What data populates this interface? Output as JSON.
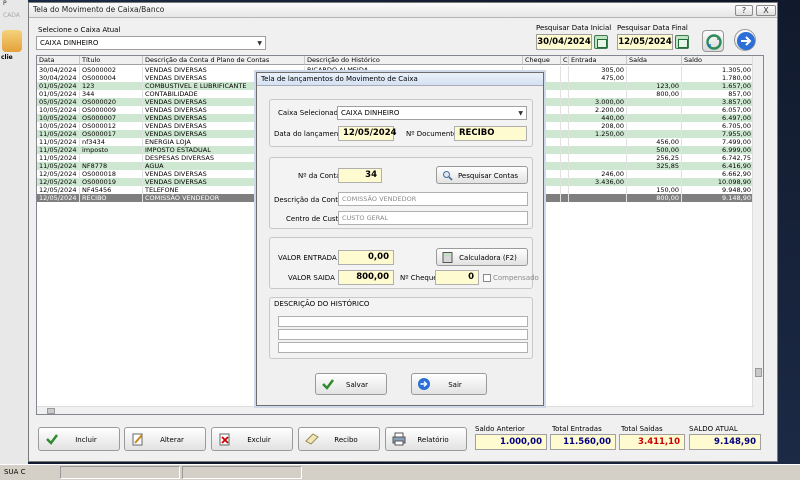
{
  "desktop": {
    "app_label": "P",
    "cad_label": "CADA",
    "user_label": "clie"
  },
  "status_bar": {
    "text": "SUA C"
  },
  "window": {
    "title": "Tela do Movimento de Caixa/Banco",
    "help_label": "?",
    "close_label": "X"
  },
  "filters": {
    "caixa_label": "Selecione o Caixa Atual",
    "caixa_value": "CAIXA DINHEIRO",
    "data_inicial_label": "Pesquisar Data Inicial",
    "data_inicial_value": "30/04/2024",
    "data_final_label": "Pesquisar Data Final",
    "data_final_value": "12/05/2024"
  },
  "grid": {
    "columns": [
      "Data",
      "Título",
      "Descrição da Conta d Plano de Contas",
      "Descrição do Histórico",
      "Cheque",
      "C",
      "Entrada",
      "Saída",
      "Saldo"
    ],
    "rows": [
      {
        "data": "30/04/2024",
        "titulo": "OS000002",
        "conta": "VENDAS DIVERSAS",
        "historico": "RICARDO ALMEIDA",
        "cheque": "",
        "c": "",
        "entrada": "305,00",
        "saida": "",
        "saldo": "1.305,00",
        "color": "white"
      },
      {
        "data": "30/04/2024",
        "titulo": "OS000004",
        "conta": "VENDAS DIVERSAS",
        "historico": "",
        "cheque": "",
        "c": "",
        "entrada": "475,00",
        "saida": "",
        "saldo": "1.780,00",
        "color": "white"
      },
      {
        "data": "01/05/2024",
        "titulo": "123",
        "conta": "COMBUSTIVEL E LUBRIFICANTE",
        "historico": "",
        "cheque": "",
        "c": "",
        "entrada": "",
        "saida": "123,00",
        "saldo": "1.657,00",
        "color": "green"
      },
      {
        "data": "01/05/2024",
        "titulo": "344",
        "conta": "CONTABILIDADE",
        "historico": "",
        "cheque": "",
        "c": "",
        "entrada": "",
        "saida": "800,00",
        "saldo": "857,00",
        "color": "white"
      },
      {
        "data": "05/05/2024",
        "titulo": "OS000020",
        "conta": "VENDAS DIVERSAS",
        "historico": "",
        "cheque": "",
        "c": "",
        "entrada": "3.000,00",
        "saida": "",
        "saldo": "3.857,00",
        "color": "green"
      },
      {
        "data": "10/05/2024",
        "titulo": "OS000009",
        "conta": "VENDAS DIVERSAS",
        "historico": "",
        "cheque": "",
        "c": "",
        "entrada": "2.200,00",
        "saida": "",
        "saldo": "6.057,00",
        "color": "white"
      },
      {
        "data": "10/05/2024",
        "titulo": "OS000007",
        "conta": "VENDAS DIVERSAS",
        "historico": "",
        "cheque": "",
        "c": "",
        "entrada": "440,00",
        "saida": "",
        "saldo": "6.497,00",
        "color": "green"
      },
      {
        "data": "10/05/2024",
        "titulo": "OS000012",
        "conta": "VENDAS DIVERSAS",
        "historico": "",
        "cheque": "",
        "c": "",
        "entrada": "208,00",
        "saida": "",
        "saldo": "6.705,00",
        "color": "white"
      },
      {
        "data": "11/05/2024",
        "titulo": "OS000017",
        "conta": "VENDAS DIVERSAS",
        "historico": "",
        "cheque": "",
        "c": "",
        "entrada": "1.250,00",
        "saida": "",
        "saldo": "7.955,00",
        "color": "green"
      },
      {
        "data": "11/05/2024",
        "titulo": "nf3434",
        "conta": "ENERGIA LOJA",
        "historico": "",
        "cheque": "",
        "c": "",
        "entrada": "",
        "saida": "456,00",
        "saldo": "7.499,00",
        "color": "white"
      },
      {
        "data": "11/05/2024",
        "titulo": "imposto",
        "conta": "IMPOSTO ESTADUAL",
        "historico": "",
        "cheque": "",
        "c": "",
        "entrada": "",
        "saida": "500,00",
        "saldo": "6.999,00",
        "color": "green"
      },
      {
        "data": "11/05/2024",
        "titulo": "",
        "conta": "DESPESAS DIVERSAS",
        "historico": "",
        "cheque": "",
        "c": "",
        "entrada": "",
        "saida": "256,25",
        "saldo": "6.742,75",
        "color": "white"
      },
      {
        "data": "11/05/2024",
        "titulo": "NF8778",
        "conta": "AGUA",
        "historico": "",
        "cheque": "",
        "c": "",
        "entrada": "",
        "saida": "325,85",
        "saldo": "6.416,90",
        "color": "green"
      },
      {
        "data": "12/05/2024",
        "titulo": "OS000018",
        "conta": "VENDAS DIVERSAS",
        "historico": "",
        "cheque": "",
        "c": "",
        "entrada": "246,00",
        "saida": "",
        "saldo": "6.662,90",
        "color": "white"
      },
      {
        "data": "12/05/2024",
        "titulo": "OS000019",
        "conta": "VENDAS DIVERSAS",
        "historico": "",
        "cheque": "",
        "c": "",
        "entrada": "3.436,00",
        "saida": "",
        "saldo": "10.098,90",
        "color": "green"
      },
      {
        "data": "12/05/2024",
        "titulo": "NF45456",
        "conta": "TELEFONE",
        "historico": "",
        "cheque": "",
        "c": "",
        "entrada": "",
        "saida": "150,00",
        "saldo": "9.948,90",
        "color": "white"
      },
      {
        "data": "12/05/2024",
        "titulo": "RECIBO",
        "conta": "COMISSÃO VENDEDOR",
        "historico": "",
        "cheque": "",
        "c": "",
        "entrada": "",
        "saida": "800,00",
        "saldo": "9.148,90",
        "color": "selected"
      }
    ]
  },
  "actions": {
    "incluir": "Incluir",
    "alterar": "Alterar",
    "excluir": "Excluir",
    "recibo": "Recibo",
    "relatorio": "Relatório"
  },
  "totals": {
    "saldo_anterior_label": "Saldo Anterior",
    "saldo_anterior_value": "1.000,00",
    "total_entradas_label": "Total Entradas",
    "total_entradas_value": "11.560,00",
    "total_saidas_label": "Total Saídas",
    "total_saidas_value": "3.411,10",
    "saldo_atual_label": "SALDO ATUAL",
    "saldo_atual_value": "9.148,90"
  },
  "dialog": {
    "title": "Tela de lançamentos do Movimento de Caixa",
    "caixa_label": "Caixa Selecionado",
    "caixa_value": "CAIXA DINHEIRO",
    "data_label": "Data do lançamento",
    "data_value": "12/05/2024",
    "documento_label": "Nº Documento",
    "documento_value": "RECIBO",
    "conta_label": "Nº da Conta",
    "conta_value": "34",
    "pesquisar_label": "Pesquisar Contas",
    "descricao_conta_label": "Descrição da Conta",
    "descricao_conta_value": "COMISSÃO VENDEDOR",
    "centro_custo_label": "Centro de Custo",
    "centro_custo_value": "CUSTO GERAL",
    "valor_entrada_label": "VALOR ENTRADA",
    "valor_entrada_value": "0,00",
    "calculadora_label": "Calculadora  (F2)",
    "valor_saida_label": "VALOR SAIDA",
    "valor_saida_value": "800,00",
    "cheque_label": "Nº Cheque",
    "cheque_value": "0",
    "compensado_label": "Compensado",
    "historico_label": "DESCRIÇÃO DO HISTÓRICO",
    "historico_lines": [
      "",
      "",
      ""
    ],
    "salvar_label": "Salvar",
    "sair_label": "Sair"
  },
  "colors": {
    "row_green": "#cde7d0",
    "row_white": "#ffffff",
    "row_selected": "#7f7f7f",
    "saidas_red": "#cc0000",
    "entradas_blue": "#000080"
  }
}
